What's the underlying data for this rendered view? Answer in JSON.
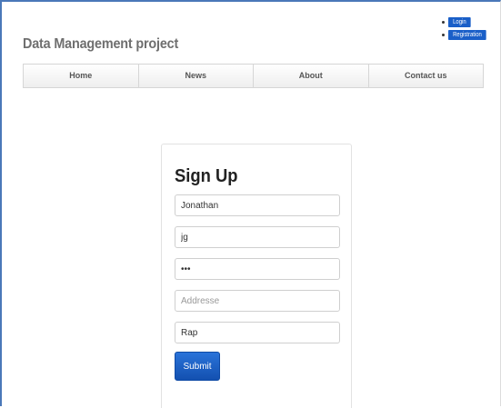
{
  "site": {
    "title": "Data Management project"
  },
  "auth": {
    "login_label": "Login",
    "register_label": "Registration"
  },
  "nav": {
    "items": [
      {
        "label": "Home"
      },
      {
        "label": "News"
      },
      {
        "label": "About"
      },
      {
        "label": "Contact us"
      }
    ]
  },
  "form": {
    "title": "Sign Up",
    "fields": [
      {
        "value": "Jonathan",
        "placeholder": ""
      },
      {
        "value": "jg",
        "placeholder": ""
      },
      {
        "value": "abc",
        "placeholder": ""
      },
      {
        "value": "",
        "placeholder": "Addresse"
      },
      {
        "value": "Rap",
        "placeholder": ""
      }
    ],
    "submit_label": "Submit"
  },
  "colors": {
    "accent": "#1a5fc8",
    "frame": "#4a78b8"
  }
}
